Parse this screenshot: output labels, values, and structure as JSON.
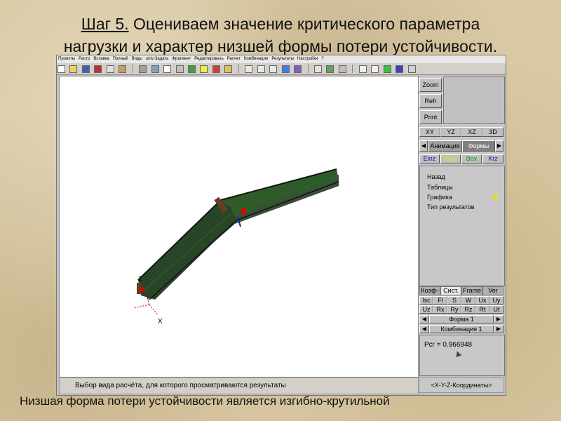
{
  "slide": {
    "title_step": "Шаг 5.",
    "title_rest": " Оцениваем значение критического параметра",
    "title_line2": "нагрузки и характер низшей формы потери устойчивости.",
    "caption": "Низшая форма потери устойчивости является изгибно-крутильной"
  },
  "menu": [
    "Проекты",
    "Растр",
    "Вставка",
    "Полный",
    "Виды",
    "univ-Задать",
    "Фрагмент",
    "Редактировать",
    "Расчет",
    "Комбинации",
    "Результаты",
    "Настройки",
    "?"
  ],
  "viewport": {
    "axis_z": "Z",
    "axis_x": "X",
    "colors": {
      "beam_dark": "#1b2a1a",
      "beam_green": "#2f5a2a",
      "marker_red": "#e00000",
      "marker_brown": "#6b3b22"
    }
  },
  "status": {
    "left": "Выбор вида расчёта, для которого просматриваются результаты",
    "right": "<X-Y-Z-Координаты>"
  },
  "side": {
    "zoom": "Zoom",
    "refr": "Refr",
    "print": "Print",
    "views": [
      "XY",
      "YZ",
      "XZ",
      "3D"
    ],
    "anim": "Анимация",
    "forms": "Формы",
    "modes": [
      {
        "label": "Einz",
        "color": "#1010c0"
      },
      {
        "label": "Auto",
        "color": "#e8e800"
      },
      {
        "label": "Box",
        "color": "#00a000"
      },
      {
        "label": "Krz",
        "color": "#1010c0"
      }
    ],
    "nav": [
      "Назад",
      "Таблицы",
      "Графика",
      "Тип результатов"
    ],
    "tabs": [
      "Коэф-т",
      "Сист.",
      "Frame",
      "Ver"
    ],
    "row1": [
      "Isc",
      "Fl",
      "S",
      "W",
      "Ux",
      "Uy"
    ],
    "row2": [
      "Uz",
      "Rx",
      "Ry",
      "Rz",
      "Rt",
      "Ut"
    ],
    "forma": "Форма  1",
    "combo": "Комбинация 1",
    "pcr": "Pcr = 0.966948"
  }
}
